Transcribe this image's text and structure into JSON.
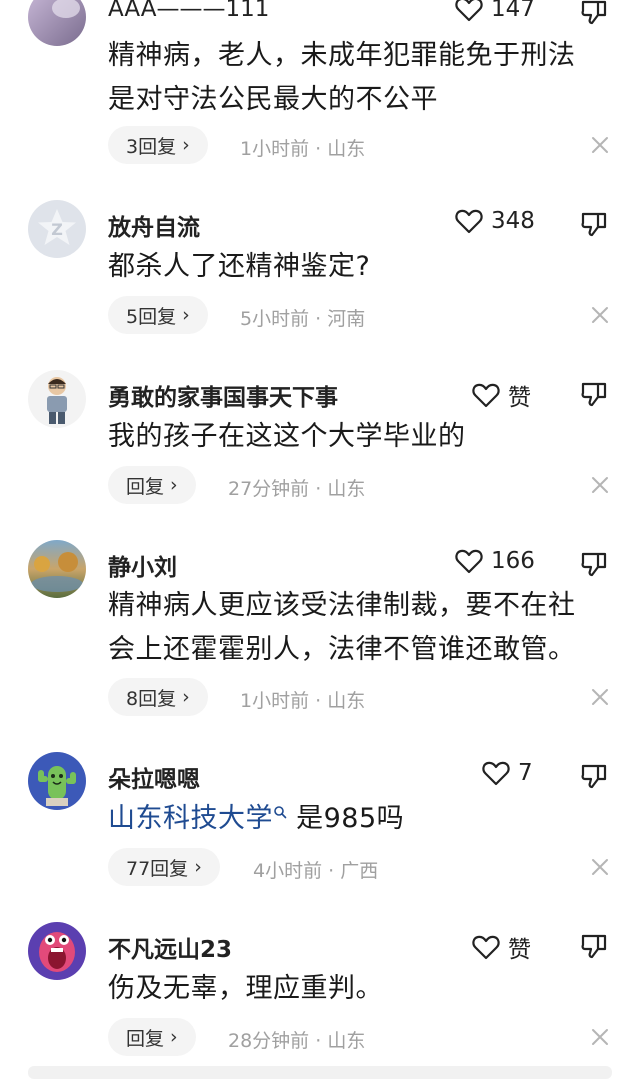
{
  "comments": [
    {
      "username": "AAA———111",
      "like_count": "147",
      "text": [
        "精神病，老人，未成年犯罪能免于刑法",
        "是对守法公民最大的不公平"
      ],
      "reply_label": "3回复",
      "time": "1小时前",
      "location": "山东"
    },
    {
      "username": "放舟自流",
      "like_count": "348",
      "text": [
        "都杀人了还精神鉴定?"
      ],
      "reply_label": "5回复",
      "time": "5小时前",
      "location": "河南"
    },
    {
      "username": "勇敢的家事国事天下事",
      "like_count": "赞",
      "text": [
        "我的孩子在这这个大学毕业的"
      ],
      "reply_label": "回复",
      "time": "27分钟前",
      "location": "山东"
    },
    {
      "username": "静小刘",
      "like_count": "166",
      "text": [
        "精神病人更应该受法律制裁，要不在社",
        "会上还霍霍别人，法律不管谁还敢管。"
      ],
      "reply_label": "8回复",
      "time": "1小时前",
      "location": "山东"
    },
    {
      "username": "朵拉嗯嗯",
      "like_count": "7",
      "text_link": "山东科技大学",
      "text_rest": " 是985吗",
      "reply_label": "77回复",
      "time": "4小时前",
      "location": "广西"
    },
    {
      "username": "不凡远山23",
      "like_count": "赞",
      "text": [
        "伤及无辜，理应重判。"
      ],
      "reply_label": "回复",
      "time": "28分钟前",
      "location": "山东"
    }
  ],
  "separator": "·",
  "reply_chevron": "›",
  "colors": {
    "link": "#1f4b91",
    "meta": "#a0a0a0",
    "pill_bg": "#f4f4f4"
  }
}
